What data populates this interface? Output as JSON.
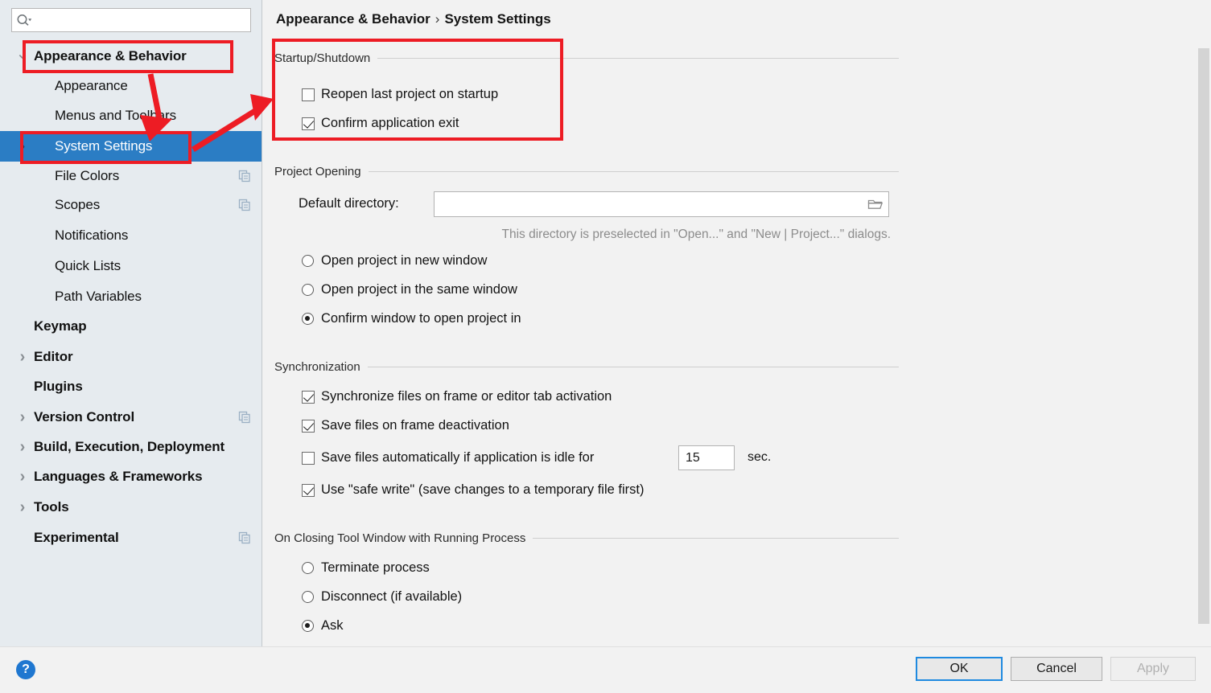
{
  "search": {
    "placeholder": "",
    "value": "",
    "icon": "search-icon"
  },
  "sidebar": {
    "items": [
      {
        "label": "Appearance & Behavior",
        "level": 0,
        "chevron": "chevron-down",
        "selected": false,
        "copy_icon": false
      },
      {
        "label": "Appearance",
        "level": 1,
        "chevron": "",
        "selected": false,
        "copy_icon": false
      },
      {
        "label": "Menus and Toolbars",
        "level": 1,
        "chevron": "",
        "selected": false,
        "copy_icon": false
      },
      {
        "label": "System Settings",
        "level": 1,
        "chevron": "chevron-right",
        "selected": true,
        "copy_icon": false
      },
      {
        "label": "File Colors",
        "level": 1,
        "chevron": "",
        "selected": false,
        "copy_icon": true
      },
      {
        "label": "Scopes",
        "level": 1,
        "chevron": "",
        "selected": false,
        "copy_icon": true
      },
      {
        "label": "Notifications",
        "level": 1,
        "chevron": "",
        "selected": false,
        "copy_icon": false
      },
      {
        "label": "Quick Lists",
        "level": 1,
        "chevron": "",
        "selected": false,
        "copy_icon": false
      },
      {
        "label": "Path Variables",
        "level": 1,
        "chevron": "",
        "selected": false,
        "copy_icon": false
      },
      {
        "label": "Keymap",
        "level": 0,
        "chevron": "",
        "selected": false,
        "copy_icon": false
      },
      {
        "label": "Editor",
        "level": 0,
        "chevron": "chevron-right",
        "selected": false,
        "copy_icon": false
      },
      {
        "label": "Plugins",
        "level": 0,
        "chevron": "",
        "selected": false,
        "copy_icon": false
      },
      {
        "label": "Version Control",
        "level": 0,
        "chevron": "chevron-right",
        "selected": false,
        "copy_icon": true
      },
      {
        "label": "Build, Execution, Deployment",
        "level": 0,
        "chevron": "chevron-right",
        "selected": false,
        "copy_icon": false
      },
      {
        "label": "Languages & Frameworks",
        "level": 0,
        "chevron": "chevron-right",
        "selected": false,
        "copy_icon": false
      },
      {
        "label": "Tools",
        "level": 0,
        "chevron": "chevron-right",
        "selected": false,
        "copy_icon": false
      },
      {
        "label": "Experimental",
        "level": 0,
        "chevron": "",
        "selected": false,
        "copy_icon": true
      }
    ]
  },
  "breadcrumb": {
    "root": "Appearance & Behavior",
    "separator": "›",
    "leaf": "System Settings"
  },
  "sections": {
    "startup": {
      "title": "Startup/Shutdown",
      "reopen_last_project": {
        "label": "Reopen last project on startup",
        "checked": false
      },
      "confirm_exit": {
        "label": "Confirm application exit",
        "checked": true
      }
    },
    "project_opening": {
      "title": "Project Opening",
      "default_directory_label": "Default directory:",
      "default_directory_value": "",
      "browse_icon": "folder-icon",
      "hint": "This directory is preselected in \"Open...\" and \"New | Project...\" dialogs.",
      "radios": [
        {
          "label": "Open project in new window",
          "checked": false
        },
        {
          "label": "Open project in the same window",
          "checked": false
        },
        {
          "label": "Confirm window to open project in",
          "checked": true
        }
      ]
    },
    "synchronization": {
      "title": "Synchronization",
      "checkboxes": [
        {
          "label": "Synchronize files on frame or editor tab activation",
          "checked": true
        },
        {
          "label": "Save files on frame deactivation",
          "checked": true
        },
        {
          "label": "Save files automatically if application is idle for",
          "checked": false
        },
        {
          "label": "Use \"safe write\" (save changes to a temporary file first)",
          "checked": true
        }
      ],
      "idle_seconds": "15",
      "seconds_unit": "sec."
    },
    "closing_tool_window": {
      "title": "On Closing Tool Window with Running Process",
      "radios": [
        {
          "label": "Terminate process",
          "checked": false
        },
        {
          "label": "Disconnect (if available)",
          "checked": false
        },
        {
          "label": "Ask",
          "checked": true
        }
      ]
    }
  },
  "footer": {
    "help_glyph": "?",
    "ok_label": "OK",
    "cancel_label": "Cancel",
    "apply_label": "Apply"
  },
  "annotations": {
    "color": "#ed1c24",
    "boxes": [
      "appearance-behavior-item",
      "system-settings-item",
      "startup-shutdown-section"
    ],
    "arrows": [
      "appearance-to-system-settings",
      "system-settings-to-startup-section"
    ]
  }
}
